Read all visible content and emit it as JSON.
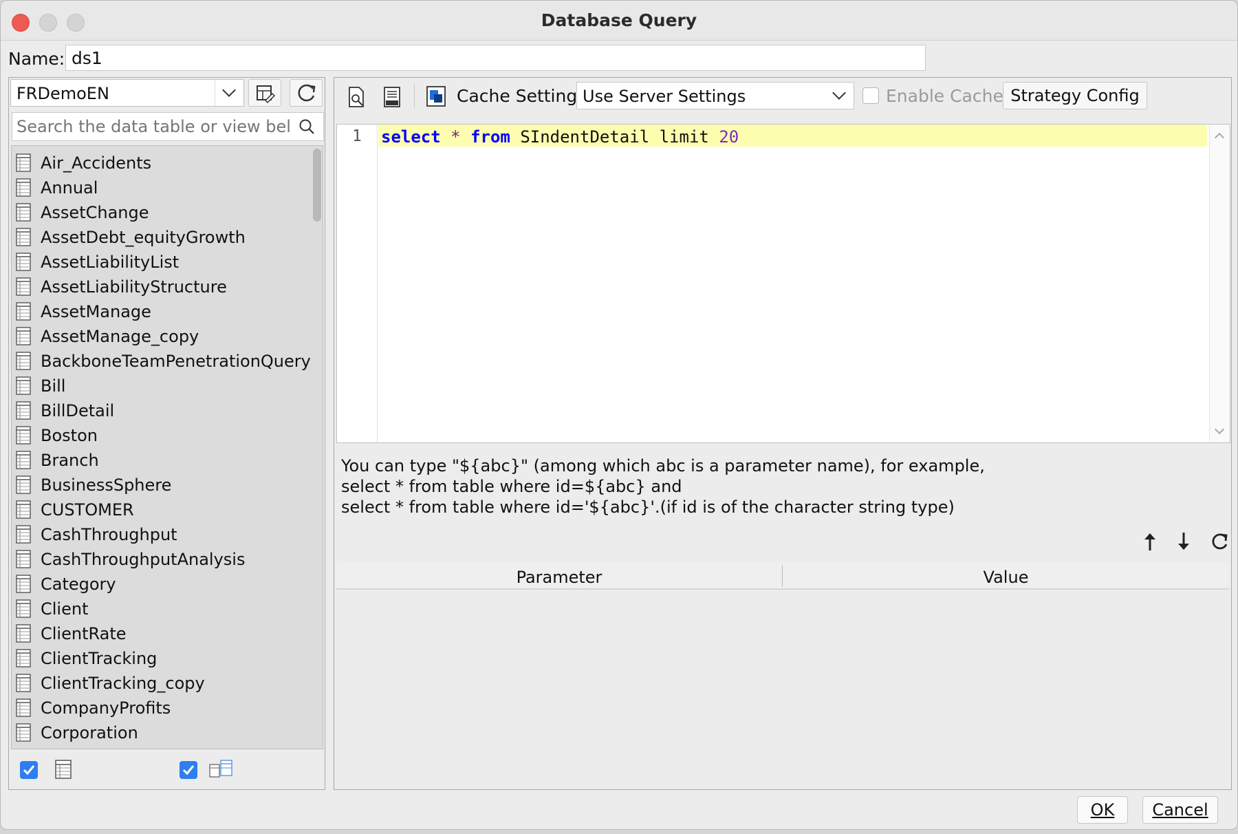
{
  "window": {
    "title": "Database Query"
  },
  "name_field": {
    "label": "Name:",
    "value": "ds1"
  },
  "left": {
    "datasource": "FRDemoEN",
    "search_placeholder": "Search the data table or view below",
    "tables": [
      "Air_Accidents",
      "Annual",
      "AssetChange",
      "AssetDebt_equityGrowth",
      "AssetLiabilityList",
      "AssetLiabilityStructure",
      "AssetManage",
      "AssetManage_copy",
      "BackboneTeamPenetrationQuery",
      "Bill",
      "BillDetail",
      "Boston",
      "Branch",
      "BusinessSphere",
      "CUSTOMER",
      "CashThroughput",
      "CashThroughputAnalysis",
      "Category",
      "Client",
      "ClientRate",
      "ClientTracking",
      "ClientTracking_copy",
      "CompanyProfits",
      "Corporation"
    ]
  },
  "right": {
    "cache_label": "Cache Settings",
    "cache_value": "Use Server Settings",
    "enable_cache": "Enable Cache",
    "strategy_button": "Strategy Config",
    "line_number": "1",
    "sql": {
      "kw_select": "select",
      "star": "*",
      "kw_from": "from",
      "rest": "SIndentDetail limit",
      "num": "20"
    },
    "help": [
      "You can type \"${abc}\" (among which abc is a parameter name), for example,",
      "select * from table where id=${abc} and",
      "select * from table where id='${abc}'.(if id is of the character string type)"
    ],
    "param_headers": {
      "parameter": "Parameter",
      "value": "Value"
    }
  },
  "buttons": {
    "ok": "OK",
    "cancel": "Cancel"
  },
  "colors": {
    "accent": "#2d7ff0",
    "editor_highlight": "#fdfdb0",
    "keyword": "#0000ff"
  }
}
